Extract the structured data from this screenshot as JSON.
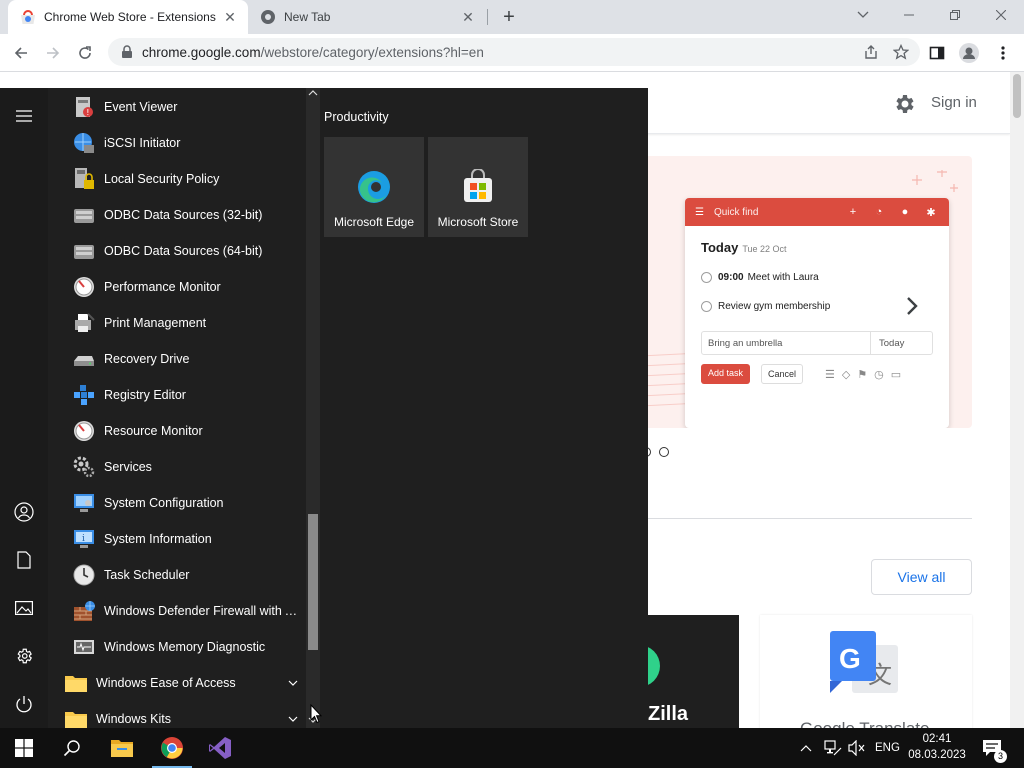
{
  "browser": {
    "tabs": [
      {
        "title": "Chrome Web Store - Extensions",
        "active": true
      },
      {
        "title": "New Tab",
        "active": false
      }
    ],
    "new_tab_symbol": "+",
    "close_symbol": "✕",
    "url_main": "chrome.google.com",
    "url_path": "/webstore/category/extensions?hl=en"
  },
  "webpage": {
    "sign_in": "Sign in",
    "view_all": "View all",
    "hero_app": {
      "search_placeholder": "Quick find",
      "today": "Today",
      "today_date": "Tue 22 Oct",
      "task1_time": "09:00",
      "task1_text": "Meet with Laura",
      "task2_text": "Review gym membership",
      "input_text": "Bring an umbrella",
      "input_due": "Today",
      "add_task": "Add task",
      "cancel": "Cancel"
    },
    "card1_label": "Zilla",
    "card2_label": "Google Translate"
  },
  "start_menu": {
    "apps": [
      {
        "label": "Event Viewer",
        "icon": "event-viewer-icon"
      },
      {
        "label": "iSCSI Initiator",
        "icon": "iscsi-initiator-icon"
      },
      {
        "label": "Local Security Policy",
        "icon": "local-security-policy-icon"
      },
      {
        "label": "ODBC Data Sources (32-bit)",
        "icon": "odbc-icon"
      },
      {
        "label": "ODBC Data Sources (64-bit)",
        "icon": "odbc-icon"
      },
      {
        "label": "Performance Monitor",
        "icon": "performance-monitor-icon"
      },
      {
        "label": "Print Management",
        "icon": "print-management-icon"
      },
      {
        "label": "Recovery Drive",
        "icon": "recovery-drive-icon"
      },
      {
        "label": "Registry Editor",
        "icon": "registry-editor-icon"
      },
      {
        "label": "Resource Monitor",
        "icon": "resource-monitor-icon"
      },
      {
        "label": "Services",
        "icon": "services-icon"
      },
      {
        "label": "System Configuration",
        "icon": "system-configuration-icon"
      },
      {
        "label": "System Information",
        "icon": "system-information-icon"
      },
      {
        "label": "Task Scheduler",
        "icon": "task-scheduler-icon"
      },
      {
        "label": "Windows Defender Firewall with Ad...",
        "icon": "firewall-icon"
      },
      {
        "label": "Windows Memory Diagnostic",
        "icon": "memory-diagnostic-icon"
      }
    ],
    "folders": [
      {
        "label": "Windows Ease of Access"
      },
      {
        "label": "Windows Kits"
      }
    ],
    "tiles_group": "Productivity",
    "tiles": [
      {
        "label": "Microsoft Edge",
        "icon": "edge-icon"
      },
      {
        "label": "Microsoft Store",
        "icon": "store-icon"
      }
    ]
  },
  "taskbar": {
    "language": "ENG",
    "time": "02:41",
    "date": "08.03.2023",
    "notification_count": "3"
  },
  "colors": {
    "accent_red": "#db4c3f",
    "start_menu_bg": "#1f1f1f",
    "link_blue": "#1a73e8"
  }
}
